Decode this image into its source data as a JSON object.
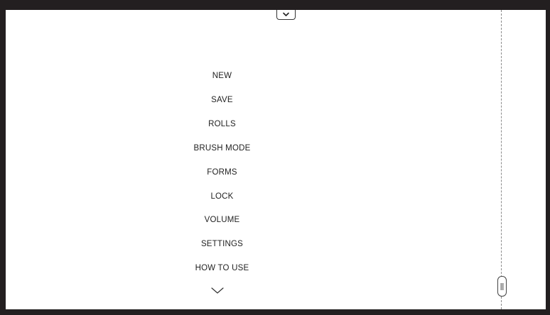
{
  "menu": {
    "items": [
      {
        "label": "NEW"
      },
      {
        "label": "SAVE"
      },
      {
        "label": "ROLLS"
      },
      {
        "label": "BRUSH MODE"
      },
      {
        "label": "FORMS"
      },
      {
        "label": "LOCK"
      },
      {
        "label": "VOLUME"
      },
      {
        "label": "SETTINGS"
      },
      {
        "label": "HOW TO USE"
      }
    ]
  },
  "icons": {
    "top_toggle": "chevron-down-icon",
    "more": "chevron-down-icon",
    "handle": "drag-handle-icon"
  },
  "colors": {
    "frame": "#231f20",
    "canvas": "#ffffff",
    "text": "#222222",
    "guide_line": "#8a8a8a"
  }
}
